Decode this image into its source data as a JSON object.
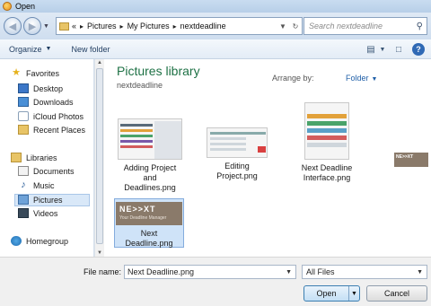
{
  "window": {
    "title": "Open"
  },
  "address_bar": {
    "prefix": "«",
    "crumbs": [
      "Pictures",
      "My Pictures",
      "nextdeadline"
    ],
    "search_placeholder": "Search nextdeadline"
  },
  "toolbar": {
    "organize_label": "Organize",
    "new_folder_label": "New folder"
  },
  "sidebar": {
    "favorites_label": "Favorites",
    "favorites": [
      "Desktop",
      "Downloads",
      "iCloud Photos",
      "Recent Places"
    ],
    "libraries_label": "Libraries",
    "libraries": [
      "Documents",
      "Music",
      "Pictures",
      "Videos"
    ],
    "homegroup_label": "Homegroup",
    "selected": "Pictures"
  },
  "content": {
    "library_title": "Pictures library",
    "library_subtitle": "nextdeadline",
    "arrange_label": "Arrange by:",
    "arrange_value": "Folder",
    "files": [
      {
        "name_line1": "Adding Project",
        "name_line2": "and",
        "name_line3": "Deadlines.png"
      },
      {
        "name_line1": "Editing",
        "name_line2": "Project.png"
      },
      {
        "name_line1": "Next Deadline",
        "name_line2": "Interface.png"
      },
      {
        "name_line1": "Next",
        "name_line2": "Deadline.png",
        "thumb_title": "NE>>XT",
        "thumb_sub": "Your Deadline Manager"
      }
    ],
    "peek_text": "NE>>XT"
  },
  "footer": {
    "file_name_label": "File name:",
    "file_name_value": "Next Deadline.png",
    "filter_value": "All Files",
    "open_label": "Open",
    "cancel_label": "Cancel"
  }
}
